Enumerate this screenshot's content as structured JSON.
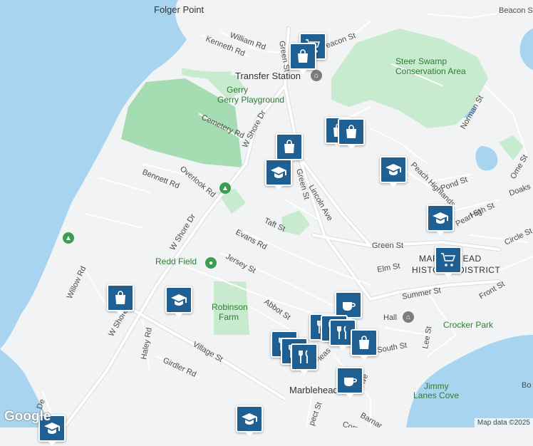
{
  "map": {
    "places": {
      "folger_point": "Folger Point",
      "transfer_station": "Transfer Station",
      "gerry_playground": "Gerry Playground",
      "steer_swamp": "Steer Swamp",
      "conservation_area": "Conservation Area",
      "redd_field": "Redd Field",
      "robinson": "Robinson",
      "farm": "Farm",
      "crocker_park": "Crocker Park",
      "jimmy": "Jimmy",
      "lanes_cove": "Lanes Cove",
      "marblehead": "Marblehead",
      "marblehead_hist_1": "MARBLEHEAD",
      "marblehead_hist_2": "HISTORIC DISTRICT",
      "hall": "Hall"
    },
    "streets": {
      "beacon_st_top": "Beacon St",
      "beacon_st_2": "Beacon St",
      "william_rd": "William Rd",
      "kenneth_rd": "Kenneth Rd",
      "green_st_top": "Green St",
      "green_st_mid": "Green St",
      "green_st_right": "Green St",
      "cemetery_rd": "Cemetery Rd",
      "w_shore_dr_1": "W Shore Dr",
      "w_shore_dr_2": "W Shore Dr",
      "w_shore_dr_3": "W Shore Dr",
      "bennett_rd": "Bennett Rd",
      "overlook_rd": "Overlook Rd",
      "lincoln_ave": "Lincoln Ave",
      "norman_st": "Norman St",
      "pond_st": "Pond St",
      "high_st": "High St",
      "pearl_st": "Pearl St",
      "ome_st": "Ome St",
      "circle_st": "Circle St",
      "doaks": "Doaks",
      "taft_st": "Taft St",
      "evans_rd": "Evans Rd",
      "jersey_st": "Jersey St",
      "elm_st": "Elm St",
      "summer_st": "Summer St",
      "front_st": "Front St",
      "abbot_st": "Abbot St",
      "willow_rd": "Willow Rd",
      "haley_rd": "Haley Rd",
      "village_st": "Village St",
      "girdler_rd": "Girdler Rd",
      "lee_st": "Lee St",
      "peach_highlands": "Peach Highlands",
      "south_st": "South St",
      "pleasant": "Pleas",
      "atlantic": "Ave",
      "prospect": "pect St",
      "barnard": "Barnar",
      "com": "Com",
      "bo": "Bo",
      "de": "De"
    },
    "attribution": "Map data ©2025",
    "logo": "Google"
  },
  "colors": {
    "water": "#a8d4f0",
    "land": "#f1f3f4",
    "park": "#c8eacf",
    "cemetery": "#a5dcb1",
    "road": "#ffffff",
    "road_outline": "#d6d9dc",
    "pin": "#1f5f91"
  },
  "pins": [
    {
      "id": "pin-shop-1",
      "icon": "shopping-cart-icon"
    },
    {
      "id": "pin-shop-2",
      "icon": "shopping-bag-icon"
    },
    {
      "id": "pin-shop-3",
      "icon": "shopping-bag-icon"
    },
    {
      "id": "pin-shop-4",
      "icon": "shopping-bag-icon"
    },
    {
      "id": "pin-school-1",
      "icon": "school-icon"
    },
    {
      "id": "pin-school-2",
      "icon": "school-icon"
    },
    {
      "id": "pin-school-3",
      "icon": "school-icon"
    },
    {
      "id": "pin-cart-2",
      "icon": "shopping-cart-icon"
    },
    {
      "id": "pin-bag-5",
      "icon": "shopping-bag-icon"
    },
    {
      "id": "pin-school-4",
      "icon": "school-icon"
    },
    {
      "id": "pin-cafe-1",
      "icon": "coffee-icon"
    },
    {
      "id": "pin-food-1",
      "icon": "restaurant-icon"
    },
    {
      "id": "pin-food-2",
      "icon": "restaurant-icon"
    },
    {
      "id": "pin-bag-6",
      "icon": "shopping-bag-icon"
    },
    {
      "id": "pin-cafe-2",
      "icon": "coffee-icon"
    },
    {
      "id": "pin-school-5",
      "icon": "school-icon"
    },
    {
      "id": "pin-school-6",
      "icon": "school-icon"
    },
    {
      "id": "pin-bag-7",
      "icon": "shopping-bag-icon"
    }
  ]
}
